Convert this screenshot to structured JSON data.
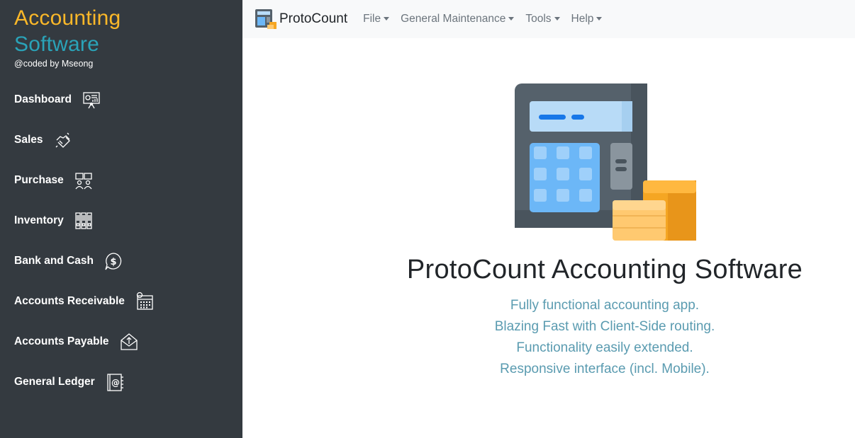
{
  "sidebar": {
    "brand_line1": "Accounting",
    "brand_line2": "Software",
    "brand_sub": "@coded by Mseong",
    "items": [
      {
        "label": "Dashboard",
        "icon": "dashboard-icon"
      },
      {
        "label": "Sales",
        "icon": "handshake-icon"
      },
      {
        "label": "Purchase",
        "icon": "purchase-icon"
      },
      {
        "label": "Inventory",
        "icon": "inventory-icon"
      },
      {
        "label": "Bank and Cash",
        "icon": "dollar-bubble-icon"
      },
      {
        "label": "Accounts Receivable",
        "icon": "calendar-icon"
      },
      {
        "label": "Accounts Payable",
        "icon": "upload-envelope-icon"
      },
      {
        "label": "General Ledger",
        "icon": "ledger-book-icon"
      }
    ]
  },
  "topbar": {
    "app_name": "ProtoCount",
    "menu": [
      "File",
      "General Maintenance",
      "Tools",
      "Help"
    ]
  },
  "main": {
    "title": "ProtoCount Accounting Software",
    "lines": [
      "Fully functional accounting app.",
      "Blazing Fast with Client-Side routing.",
      "Functionality easily extended.",
      "Responsive interface (incl. Mobile)."
    ]
  },
  "colors": {
    "sidebar_bg": "#343a40",
    "brand_yellow": "#fbb829",
    "brand_teal": "#2aa3b8",
    "tagline": "#5a9bb0"
  }
}
